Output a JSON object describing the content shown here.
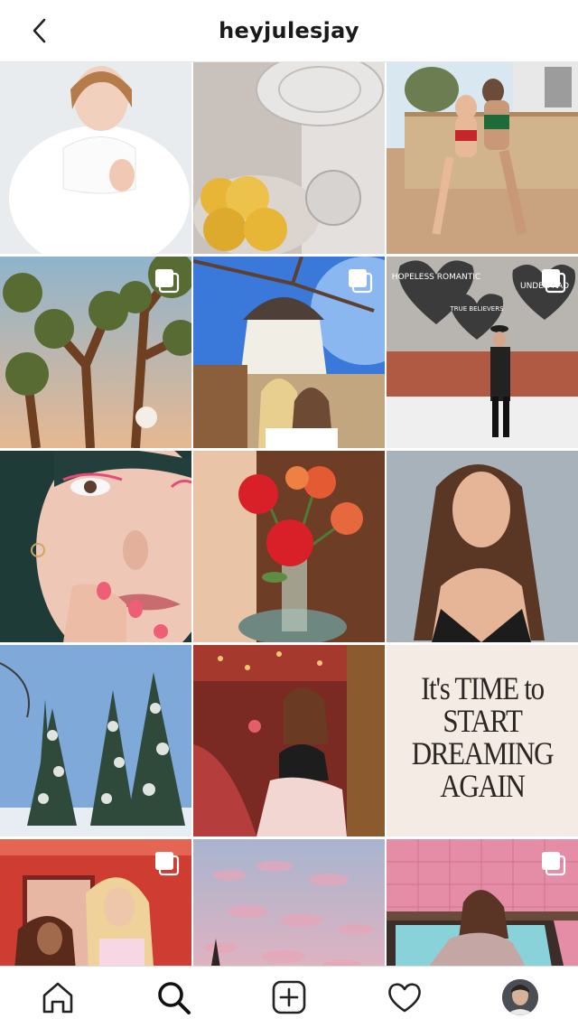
{
  "header": {
    "title": "heyjulesjay"
  },
  "posts": [
    {
      "label": "Portrait in white turtleneck",
      "multi": false
    },
    {
      "label": "Glassware and pears",
      "multi": false
    },
    {
      "label": "Two women in swimsuits by the trailer",
      "multi": false
    },
    {
      "label": "Joshua trees at sunset",
      "multi": true
    },
    {
      "label": "Windmill selfie",
      "multi": true
    },
    {
      "label": "Hopeless romantic mural",
      "multi": true
    },
    {
      "label": "Pink eyeliner close-up",
      "multi": false
    },
    {
      "label": "Red flowers in vase",
      "multi": false
    },
    {
      "label": "Portrait in black top",
      "multi": false
    },
    {
      "label": "Snowy pine trees",
      "multi": false
    },
    {
      "label": "Red bar toast",
      "multi": false
    },
    {
      "label": "Quote graphic",
      "multi": false,
      "quote": "It's TIME to\nSTART\nDREAMING\nAGAIN"
    },
    {
      "label": "Two women in pink room",
      "multi": true
    },
    {
      "label": "Pink cloudy sky",
      "multi": false
    },
    {
      "label": "Sequin jumpsuit in pink bathtub",
      "multi": true
    }
  ],
  "mural": {
    "heart1": "HOPELESS ROMANTIC",
    "heart2": "TRUE BELIEVERS",
    "heart3": "UNDER RAD"
  },
  "bottom_nav": [
    "home-icon",
    "search-icon",
    "add-post-icon",
    "heart-icon",
    "profile-avatar"
  ]
}
